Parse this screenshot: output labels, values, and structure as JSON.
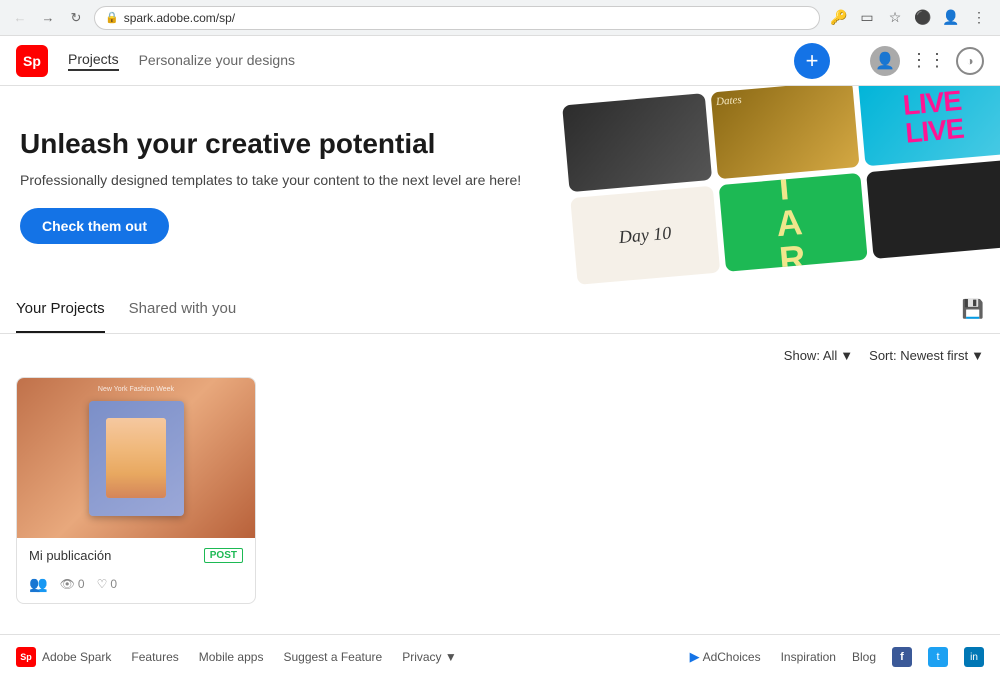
{
  "browser": {
    "url": "spark.adobe.com/sp/",
    "back_disabled": false,
    "forward_disabled": true
  },
  "nav": {
    "logo": "Sp",
    "projects_label": "Projects",
    "personalize_label": "Personalize your designs",
    "add_button_label": "+"
  },
  "hero": {
    "title": "Unleash your creative potential",
    "subtitle": "Professionally designed templates to take your content to the next level are here!",
    "cta_label": "Check them out",
    "images": {
      "card3_text": "LIVE\nLIVE",
      "card4_text": "Day 10",
      "card5_text": "T\nA\nR"
    }
  },
  "tabs": {
    "your_projects": "Your Projects",
    "shared_with_you": "Shared with you"
  },
  "toolbar": {
    "show_label": "Show: All",
    "sort_label": "Sort: Newest first"
  },
  "projects": [
    {
      "name": "Mi publicación",
      "type": "POST",
      "views": "0",
      "likes": "0"
    }
  ],
  "footer": {
    "logo": "Sp",
    "brand": "Adobe Spark",
    "links": [
      "Features",
      "Mobile apps",
      "Suggest a Feature",
      "Privacy"
    ],
    "privacy_icon": "▾",
    "adchoices": "AdChoices",
    "right_links": [
      "Inspiration",
      "Blog"
    ],
    "social": [
      "f",
      "t",
      "in"
    ]
  }
}
